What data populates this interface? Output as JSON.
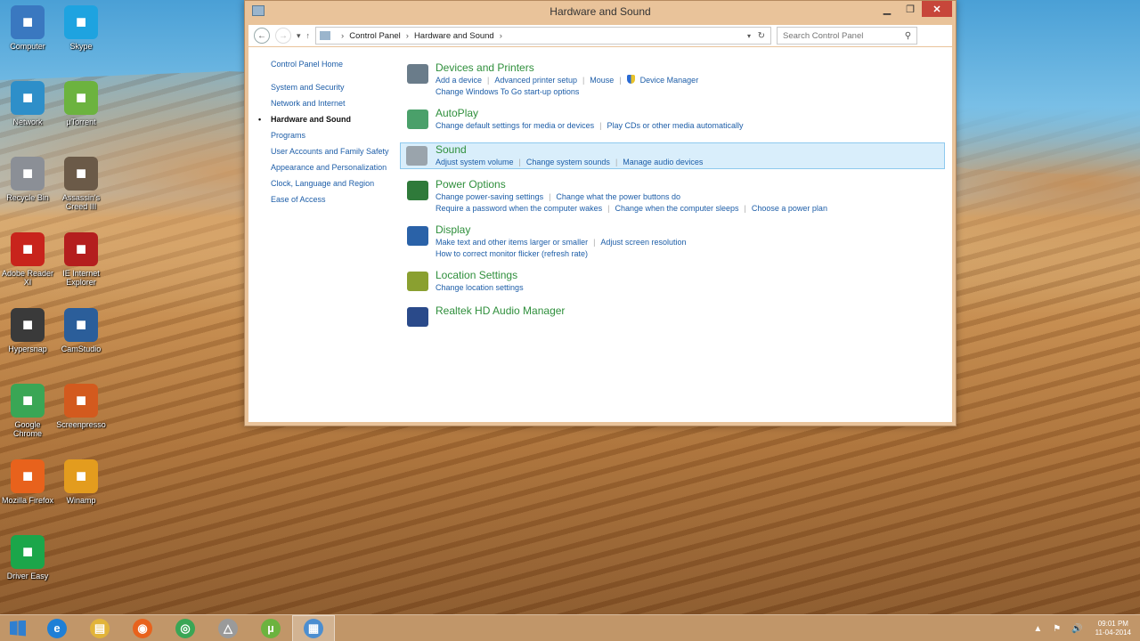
{
  "desktop": {
    "icons_col1": [
      {
        "label": "Computer",
        "icon": "computer-icon",
        "color": "#3a78c0"
      },
      {
        "label": "Network",
        "icon": "network-icon",
        "color": "#2e8fc9"
      },
      {
        "label": "Recycle Bin",
        "icon": "recycle-bin-icon",
        "color": "#8b8f96"
      },
      {
        "label": "Adobe Reader XI",
        "icon": "pdf-icon",
        "color": "#c8241c"
      },
      {
        "label": "Hypersnap",
        "icon": "magnifier-icon",
        "color": "#3a3a3a"
      },
      {
        "label": "Google Chrome",
        "icon": "chrome-icon",
        "color": "#3aa655"
      },
      {
        "label": "Mozilla Firefox",
        "icon": "firefox-icon",
        "color": "#e8621c"
      },
      {
        "label": "Driver Easy",
        "icon": "gear-icon",
        "color": "#1ba64a"
      }
    ],
    "icons_col2": [
      {
        "label": "Skype",
        "icon": "skype-icon",
        "color": "#1ea3e0"
      },
      {
        "label": "µTorrent",
        "icon": "utorrent-icon",
        "color": "#6cb33f"
      },
      {
        "label": "Assassin's Creed III",
        "icon": "game-icon",
        "color": "#6b5a48"
      },
      {
        "label": "IE Internet Explorer",
        "icon": "book-icon",
        "color": "#b41e1e"
      },
      {
        "label": "CamStudio",
        "icon": "screen-icon",
        "color": "#2b5e9a"
      },
      {
        "label": "Screenpresso",
        "icon": "screenshot-icon",
        "color": "#d35a1e"
      },
      {
        "label": "Winamp",
        "icon": "media-icon",
        "color": "#e39c1e"
      }
    ]
  },
  "window": {
    "title": "Hardware and Sound",
    "minimize": "▁",
    "maximize": "❐",
    "close": "✕",
    "nav": {
      "back": "←",
      "forward": "→",
      "recent": "▾",
      "up": "↑"
    },
    "breadcrumb": [
      "Control Panel",
      "Hardware and Sound"
    ],
    "crumb_sep": "›",
    "search_placeholder": "Search Control Panel"
  },
  "leftnav": {
    "home": "Control Panel Home",
    "items": [
      "System and Security",
      "Network and Internet",
      "Hardware and Sound",
      "Programs",
      "User Accounts and Family Safety",
      "Appearance and Personalization",
      "Clock, Language and Region",
      "Ease of Access"
    ],
    "active_index": 2
  },
  "categories": [
    {
      "title": "Devices and Printers",
      "icon": "printer-icon",
      "links_line1": [
        "Add a device",
        "Advanced printer setup",
        "Mouse",
        "Device Manager"
      ],
      "links_line2": [
        "Change Windows To Go start-up options"
      ]
    },
    {
      "title": "AutoPlay",
      "icon": "autoplay-icon",
      "links_line1": [
        "Change default settings for media or devices",
        "Play CDs or other media automatically"
      ],
      "links_line2": []
    },
    {
      "title": "Sound",
      "icon": "speaker-icon",
      "links_line1": [
        "Adjust system volume",
        "Change system sounds",
        "Manage audio devices"
      ],
      "links_line2": []
    },
    {
      "title": "Power Options",
      "icon": "power-icon",
      "links_line1": [
        "Change power-saving settings",
        "Change what the power buttons do"
      ],
      "links_line2": [
        "Require a password when the computer wakes",
        "Change when the computer sleeps",
        "Choose a power plan"
      ]
    },
    {
      "title": "Display",
      "icon": "display-icon",
      "links_line1": [
        "Make text and other items larger or smaller",
        "Adjust screen resolution"
      ],
      "links_line2": [
        "How to correct monitor flicker (refresh rate)"
      ]
    },
    {
      "title": "Location Settings",
      "icon": "location-icon",
      "links_line1": [
        "Change location settings"
      ],
      "links_line2": []
    },
    {
      "title": "Realtek HD Audio Manager",
      "icon": "audio-manager-icon",
      "links_line1": [],
      "links_line2": []
    }
  ],
  "highlighted_category": 2,
  "taskbar": {
    "apps": [
      {
        "name": "internet-explorer",
        "glyph": "e",
        "color": "#1e7fd6"
      },
      {
        "name": "file-explorer",
        "glyph": "▤",
        "color": "#e2b43a"
      },
      {
        "name": "firefox",
        "glyph": "◉",
        "color": "#e8621c"
      },
      {
        "name": "chrome",
        "glyph": "◎",
        "color": "#3aa655"
      },
      {
        "name": "recycle",
        "glyph": "△",
        "color": "#9a9a9a"
      },
      {
        "name": "utorrent",
        "glyph": "µ",
        "color": "#6cb33f"
      },
      {
        "name": "control-panel",
        "glyph": "▦",
        "color": "#4c8ed0"
      }
    ],
    "active_app": 6,
    "tray": {
      "arrow": "▲",
      "flag": "⚑",
      "volume": "🔊"
    },
    "time": "09:01 PM",
    "date": "11-04-2014"
  }
}
